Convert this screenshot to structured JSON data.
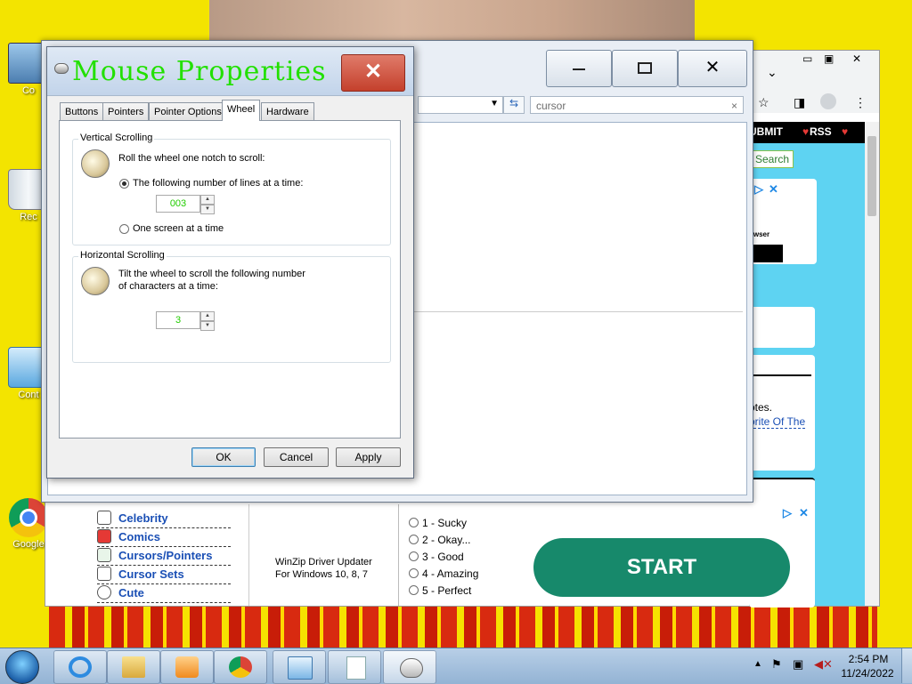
{
  "desktop": {
    "icons": [
      {
        "label": "Co",
        "icon": "computer-icon"
      },
      {
        "label": "Rec",
        "icon": "recycle-bin-icon"
      },
      {
        "label": "Cont",
        "icon": "control-panel-icon"
      },
      {
        "label": "Google",
        "icon": "chrome-shortcut-icon"
      }
    ]
  },
  "explorer": {
    "search_placeholder": "cursor",
    "search_clear": "×"
  },
  "browser": {
    "nav_submit": "UBMIT",
    "nav_rss": "RSS",
    "search_button": "Search",
    "ad_browser_text": "owser",
    "notes_text": "otes.",
    "favorite_link": "orite Of The",
    "sidebar_items": [
      {
        "label": "Celebrity",
        "icon": "celebrity-icon"
      },
      {
        "label": "Comics",
        "icon": "superman-icon"
      },
      {
        "label": "Cursors/Pointers",
        "icon": "cursor-icon"
      },
      {
        "label": "Cursor Sets",
        "icon": "cursor-set-icon"
      },
      {
        "label": "Cute",
        "icon": "smiley-icon"
      }
    ],
    "winzip_line1": "WinZip Driver Updater",
    "winzip_line2": "For Windows 10, 8, 7",
    "poll_options": [
      "1 - Sucky",
      "2 - Okay...",
      "3 - Good",
      "4 - Amazing",
      "5 - Perfect"
    ],
    "start_button": "START"
  },
  "dialog": {
    "title": "Mouse Properties",
    "close_glyph": "✕",
    "tabs": [
      "Buttons",
      "Pointers",
      "Pointer Options",
      "Wheel",
      "Hardware"
    ],
    "active_tab": "Wheel",
    "vertical": {
      "group_title": "Vertical Scrolling",
      "description": "Roll the wheel one notch to scroll:",
      "option_lines": "The following number of lines at a time:",
      "lines_value": "003",
      "option_screen": "One screen at a time"
    },
    "horizontal": {
      "group_title": "Horizontal Scrolling",
      "description_line1": "Tilt the wheel to scroll the following number",
      "description_line2": "of characters at a time:",
      "chars_value": "3"
    },
    "buttons": {
      "ok": "OK",
      "cancel": "Cancel",
      "apply": "Apply"
    }
  },
  "taskbar": {
    "time": "2:54 PM",
    "date": "11/24/2022",
    "apps": [
      "start-orb",
      "internet-explorer",
      "file-explorer",
      "media-player",
      "chrome",
      "control-panel",
      "notepad",
      "mouse-properties"
    ]
  },
  "colors": {
    "desktop_yellow": "#f3e400",
    "dialog_title_green": "#22e000",
    "spin_value_green": "#22cc00",
    "close_red": "#c4402c"
  }
}
